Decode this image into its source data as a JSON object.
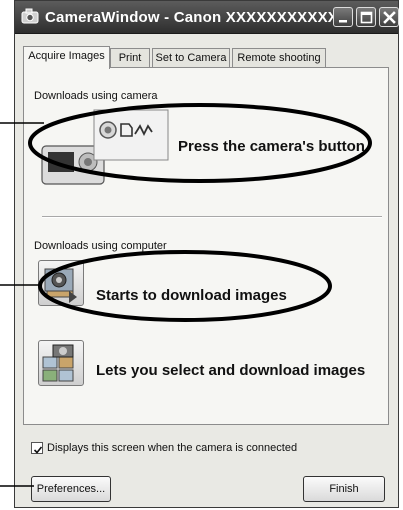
{
  "window": {
    "title": "CameraWindow - Canon XXXXXXXXXXX",
    "controls": {
      "minimize": "minimize",
      "maximize": "maximize",
      "close": "close"
    }
  },
  "tabs": [
    {
      "label": "Acquire Images",
      "active": true
    },
    {
      "label": "Print",
      "active": false
    },
    {
      "label": "Set to Camera",
      "active": false
    },
    {
      "label": "Remote shooting",
      "active": false
    }
  ],
  "sections": {
    "camera": {
      "label": "Downloads using camera",
      "action": "Press the camera's button",
      "icon": "camera-button-icon"
    },
    "computer": {
      "label": "Downloads using computer",
      "actions": [
        {
          "text": "Starts to download images",
          "icon": "download-images-icon"
        },
        {
          "text": "Lets you select and download images",
          "icon": "select-download-icon"
        }
      ]
    }
  },
  "options": {
    "show_on_connect_label": "Displays this screen when the camera is connected",
    "show_on_connect_checked": true
  },
  "buttons": {
    "preferences": "Preferences...",
    "finish": "Finish"
  },
  "colors": {
    "titlebar": "#3a3a3a",
    "window_bg": "#e9e9e4",
    "panel_bg": "#f6f6f3",
    "annotation": "#000000"
  }
}
